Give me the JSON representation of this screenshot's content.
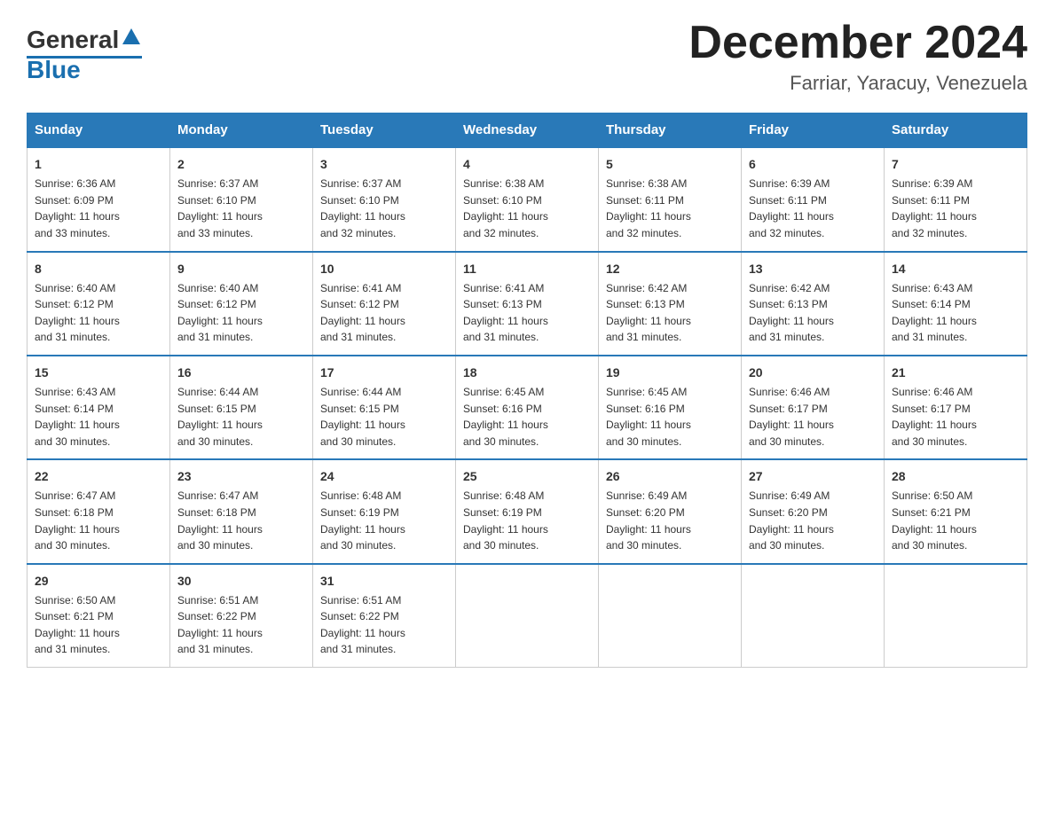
{
  "logo": {
    "general": "General",
    "blue": "Blue",
    "triangle": "▲"
  },
  "title": {
    "month_year": "December 2024",
    "location": "Farriar, Yaracuy, Venezuela"
  },
  "days_of_week": [
    "Sunday",
    "Monday",
    "Tuesday",
    "Wednesday",
    "Thursday",
    "Friday",
    "Saturday"
  ],
  "weeks": [
    [
      {
        "num": "1",
        "sunrise": "6:36 AM",
        "sunset": "6:09 PM",
        "daylight": "11 hours and 33 minutes."
      },
      {
        "num": "2",
        "sunrise": "6:37 AM",
        "sunset": "6:10 PM",
        "daylight": "11 hours and 33 minutes."
      },
      {
        "num": "3",
        "sunrise": "6:37 AM",
        "sunset": "6:10 PM",
        "daylight": "11 hours and 32 minutes."
      },
      {
        "num": "4",
        "sunrise": "6:38 AM",
        "sunset": "6:10 PM",
        "daylight": "11 hours and 32 minutes."
      },
      {
        "num": "5",
        "sunrise": "6:38 AM",
        "sunset": "6:11 PM",
        "daylight": "11 hours and 32 minutes."
      },
      {
        "num": "6",
        "sunrise": "6:39 AM",
        "sunset": "6:11 PM",
        "daylight": "11 hours and 32 minutes."
      },
      {
        "num": "7",
        "sunrise": "6:39 AM",
        "sunset": "6:11 PM",
        "daylight": "11 hours and 32 minutes."
      }
    ],
    [
      {
        "num": "8",
        "sunrise": "6:40 AM",
        "sunset": "6:12 PM",
        "daylight": "11 hours and 31 minutes."
      },
      {
        "num": "9",
        "sunrise": "6:40 AM",
        "sunset": "6:12 PM",
        "daylight": "11 hours and 31 minutes."
      },
      {
        "num": "10",
        "sunrise": "6:41 AM",
        "sunset": "6:12 PM",
        "daylight": "11 hours and 31 minutes."
      },
      {
        "num": "11",
        "sunrise": "6:41 AM",
        "sunset": "6:13 PM",
        "daylight": "11 hours and 31 minutes."
      },
      {
        "num": "12",
        "sunrise": "6:42 AM",
        "sunset": "6:13 PM",
        "daylight": "11 hours and 31 minutes."
      },
      {
        "num": "13",
        "sunrise": "6:42 AM",
        "sunset": "6:13 PM",
        "daylight": "11 hours and 31 minutes."
      },
      {
        "num": "14",
        "sunrise": "6:43 AM",
        "sunset": "6:14 PM",
        "daylight": "11 hours and 31 minutes."
      }
    ],
    [
      {
        "num": "15",
        "sunrise": "6:43 AM",
        "sunset": "6:14 PM",
        "daylight": "11 hours and 30 minutes."
      },
      {
        "num": "16",
        "sunrise": "6:44 AM",
        "sunset": "6:15 PM",
        "daylight": "11 hours and 30 minutes."
      },
      {
        "num": "17",
        "sunrise": "6:44 AM",
        "sunset": "6:15 PM",
        "daylight": "11 hours and 30 minutes."
      },
      {
        "num": "18",
        "sunrise": "6:45 AM",
        "sunset": "6:16 PM",
        "daylight": "11 hours and 30 minutes."
      },
      {
        "num": "19",
        "sunrise": "6:45 AM",
        "sunset": "6:16 PM",
        "daylight": "11 hours and 30 minutes."
      },
      {
        "num": "20",
        "sunrise": "6:46 AM",
        "sunset": "6:17 PM",
        "daylight": "11 hours and 30 minutes."
      },
      {
        "num": "21",
        "sunrise": "6:46 AM",
        "sunset": "6:17 PM",
        "daylight": "11 hours and 30 minutes."
      }
    ],
    [
      {
        "num": "22",
        "sunrise": "6:47 AM",
        "sunset": "6:18 PM",
        "daylight": "11 hours and 30 minutes."
      },
      {
        "num": "23",
        "sunrise": "6:47 AM",
        "sunset": "6:18 PM",
        "daylight": "11 hours and 30 minutes."
      },
      {
        "num": "24",
        "sunrise": "6:48 AM",
        "sunset": "6:19 PM",
        "daylight": "11 hours and 30 minutes."
      },
      {
        "num": "25",
        "sunrise": "6:48 AM",
        "sunset": "6:19 PM",
        "daylight": "11 hours and 30 minutes."
      },
      {
        "num": "26",
        "sunrise": "6:49 AM",
        "sunset": "6:20 PM",
        "daylight": "11 hours and 30 minutes."
      },
      {
        "num": "27",
        "sunrise": "6:49 AM",
        "sunset": "6:20 PM",
        "daylight": "11 hours and 30 minutes."
      },
      {
        "num": "28",
        "sunrise": "6:50 AM",
        "sunset": "6:21 PM",
        "daylight": "11 hours and 30 minutes."
      }
    ],
    [
      {
        "num": "29",
        "sunrise": "6:50 AM",
        "sunset": "6:21 PM",
        "daylight": "11 hours and 31 minutes."
      },
      {
        "num": "30",
        "sunrise": "6:51 AM",
        "sunset": "6:22 PM",
        "daylight": "11 hours and 31 minutes."
      },
      {
        "num": "31",
        "sunrise": "6:51 AM",
        "sunset": "6:22 PM",
        "daylight": "11 hours and 31 minutes."
      },
      null,
      null,
      null,
      null
    ]
  ],
  "labels": {
    "sunrise": "Sunrise:",
    "sunset": "Sunset:",
    "daylight": "Daylight:"
  }
}
